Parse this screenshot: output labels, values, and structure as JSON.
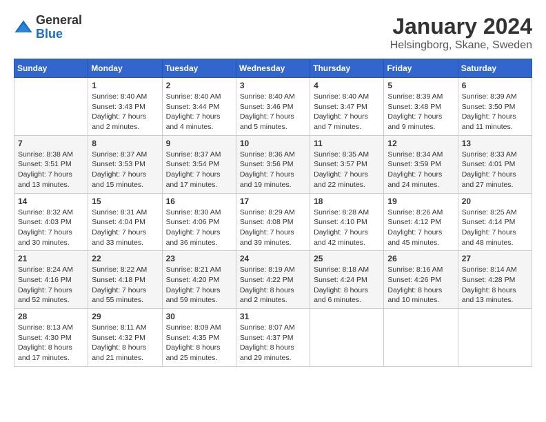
{
  "header": {
    "logo_general": "General",
    "logo_blue": "Blue",
    "month_title": "January 2024",
    "location": "Helsingborg, Skane, Sweden"
  },
  "weekdays": [
    "Sunday",
    "Monday",
    "Tuesday",
    "Wednesday",
    "Thursday",
    "Friday",
    "Saturday"
  ],
  "weeks": [
    [
      {
        "day": "",
        "info": ""
      },
      {
        "day": "1",
        "info": "Sunrise: 8:40 AM\nSunset: 3:43 PM\nDaylight: 7 hours\nand 2 minutes."
      },
      {
        "day": "2",
        "info": "Sunrise: 8:40 AM\nSunset: 3:44 PM\nDaylight: 7 hours\nand 4 minutes."
      },
      {
        "day": "3",
        "info": "Sunrise: 8:40 AM\nSunset: 3:46 PM\nDaylight: 7 hours\nand 5 minutes."
      },
      {
        "day": "4",
        "info": "Sunrise: 8:40 AM\nSunset: 3:47 PM\nDaylight: 7 hours\nand 7 minutes."
      },
      {
        "day": "5",
        "info": "Sunrise: 8:39 AM\nSunset: 3:48 PM\nDaylight: 7 hours\nand 9 minutes."
      },
      {
        "day": "6",
        "info": "Sunrise: 8:39 AM\nSunset: 3:50 PM\nDaylight: 7 hours\nand 11 minutes."
      }
    ],
    [
      {
        "day": "7",
        "info": "Sunrise: 8:38 AM\nSunset: 3:51 PM\nDaylight: 7 hours\nand 13 minutes."
      },
      {
        "day": "8",
        "info": "Sunrise: 8:37 AM\nSunset: 3:53 PM\nDaylight: 7 hours\nand 15 minutes."
      },
      {
        "day": "9",
        "info": "Sunrise: 8:37 AM\nSunset: 3:54 PM\nDaylight: 7 hours\nand 17 minutes."
      },
      {
        "day": "10",
        "info": "Sunrise: 8:36 AM\nSunset: 3:56 PM\nDaylight: 7 hours\nand 19 minutes."
      },
      {
        "day": "11",
        "info": "Sunrise: 8:35 AM\nSunset: 3:57 PM\nDaylight: 7 hours\nand 22 minutes."
      },
      {
        "day": "12",
        "info": "Sunrise: 8:34 AM\nSunset: 3:59 PM\nDaylight: 7 hours\nand 24 minutes."
      },
      {
        "day": "13",
        "info": "Sunrise: 8:33 AM\nSunset: 4:01 PM\nDaylight: 7 hours\nand 27 minutes."
      }
    ],
    [
      {
        "day": "14",
        "info": "Sunrise: 8:32 AM\nSunset: 4:03 PM\nDaylight: 7 hours\nand 30 minutes."
      },
      {
        "day": "15",
        "info": "Sunrise: 8:31 AM\nSunset: 4:04 PM\nDaylight: 7 hours\nand 33 minutes."
      },
      {
        "day": "16",
        "info": "Sunrise: 8:30 AM\nSunset: 4:06 PM\nDaylight: 7 hours\nand 36 minutes."
      },
      {
        "day": "17",
        "info": "Sunrise: 8:29 AM\nSunset: 4:08 PM\nDaylight: 7 hours\nand 39 minutes."
      },
      {
        "day": "18",
        "info": "Sunrise: 8:28 AM\nSunset: 4:10 PM\nDaylight: 7 hours\nand 42 minutes."
      },
      {
        "day": "19",
        "info": "Sunrise: 8:26 AM\nSunset: 4:12 PM\nDaylight: 7 hours\nand 45 minutes."
      },
      {
        "day": "20",
        "info": "Sunrise: 8:25 AM\nSunset: 4:14 PM\nDaylight: 7 hours\nand 48 minutes."
      }
    ],
    [
      {
        "day": "21",
        "info": "Sunrise: 8:24 AM\nSunset: 4:16 PM\nDaylight: 7 hours\nand 52 minutes."
      },
      {
        "day": "22",
        "info": "Sunrise: 8:22 AM\nSunset: 4:18 PM\nDaylight: 7 hours\nand 55 minutes."
      },
      {
        "day": "23",
        "info": "Sunrise: 8:21 AM\nSunset: 4:20 PM\nDaylight: 7 hours\nand 59 minutes."
      },
      {
        "day": "24",
        "info": "Sunrise: 8:19 AM\nSunset: 4:22 PM\nDaylight: 8 hours\nand 2 minutes."
      },
      {
        "day": "25",
        "info": "Sunrise: 8:18 AM\nSunset: 4:24 PM\nDaylight: 8 hours\nand 6 minutes."
      },
      {
        "day": "26",
        "info": "Sunrise: 8:16 AM\nSunset: 4:26 PM\nDaylight: 8 hours\nand 10 minutes."
      },
      {
        "day": "27",
        "info": "Sunrise: 8:14 AM\nSunset: 4:28 PM\nDaylight: 8 hours\nand 13 minutes."
      }
    ],
    [
      {
        "day": "28",
        "info": "Sunrise: 8:13 AM\nSunset: 4:30 PM\nDaylight: 8 hours\nand 17 minutes."
      },
      {
        "day": "29",
        "info": "Sunrise: 8:11 AM\nSunset: 4:32 PM\nDaylight: 8 hours\nand 21 minutes."
      },
      {
        "day": "30",
        "info": "Sunrise: 8:09 AM\nSunset: 4:35 PM\nDaylight: 8 hours\nand 25 minutes."
      },
      {
        "day": "31",
        "info": "Sunrise: 8:07 AM\nSunset: 4:37 PM\nDaylight: 8 hours\nand 29 minutes."
      },
      {
        "day": "",
        "info": ""
      },
      {
        "day": "",
        "info": ""
      },
      {
        "day": "",
        "info": ""
      }
    ]
  ]
}
